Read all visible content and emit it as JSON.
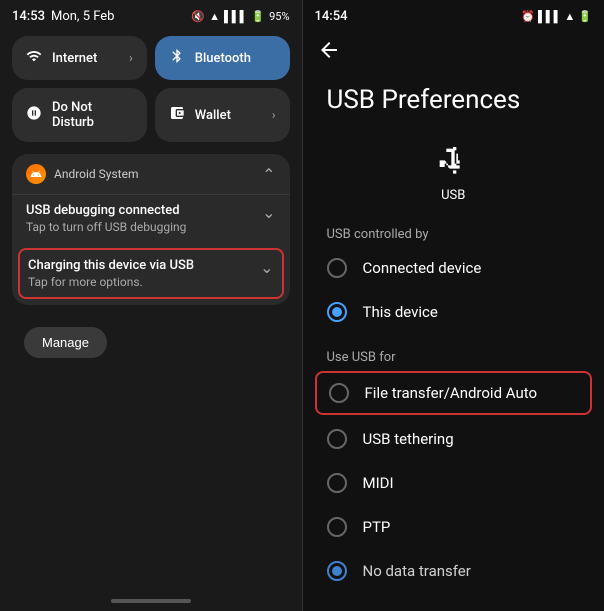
{
  "left": {
    "statusBar": {
      "time": "14:53",
      "date": "Mon, 5 Feb",
      "batteryIcon": "🔋",
      "batteryPercent": "95%"
    },
    "tiles": [
      {
        "id": "internet",
        "icon": "wifi",
        "label": "Internet",
        "hasChevron": true,
        "active": false
      },
      {
        "id": "bluetooth",
        "icon": "bluetooth",
        "label": "Bluetooth",
        "hasChevron": false,
        "active": true
      },
      {
        "id": "do-not-disturb",
        "icon": "dnd",
        "label": "Do Not Disturb",
        "hasChevron": false,
        "active": false
      },
      {
        "id": "wallet",
        "icon": "wallet",
        "label": "Wallet",
        "hasChevron": true,
        "active": false
      }
    ],
    "notification": {
      "appName": "Android System",
      "items": [
        {
          "title": "USB debugging connected",
          "subtitle": "Tap to turn off USB debugging",
          "highlighted": false
        },
        {
          "title": "Charging this device via USB",
          "subtitle": "Tap for more options.",
          "highlighted": true
        }
      ]
    },
    "manageBtn": "Manage"
  },
  "right": {
    "statusBar": {
      "time": "14:54"
    },
    "pageTitle": "USB Preferences",
    "usbLabel": "USB",
    "controlledByLabel": "USB controlled by",
    "controlledByOptions": [
      {
        "id": "connected-device",
        "label": "Connected device",
        "selected": false
      },
      {
        "id": "this-device",
        "label": "This device",
        "selected": true
      }
    ],
    "useForLabel": "Use USB for",
    "useForOptions": [
      {
        "id": "file-transfer",
        "label": "File transfer/Android Auto",
        "selected": false,
        "highlighted": true
      },
      {
        "id": "usb-tethering",
        "label": "USB tethering",
        "selected": false,
        "highlighted": false
      },
      {
        "id": "midi",
        "label": "MIDI",
        "selected": false,
        "highlighted": false
      },
      {
        "id": "ptp",
        "label": "PTP",
        "selected": false,
        "highlighted": false
      },
      {
        "id": "no-data-transfer",
        "label": "No data transfer",
        "selected": true,
        "highlighted": false
      }
    ]
  }
}
